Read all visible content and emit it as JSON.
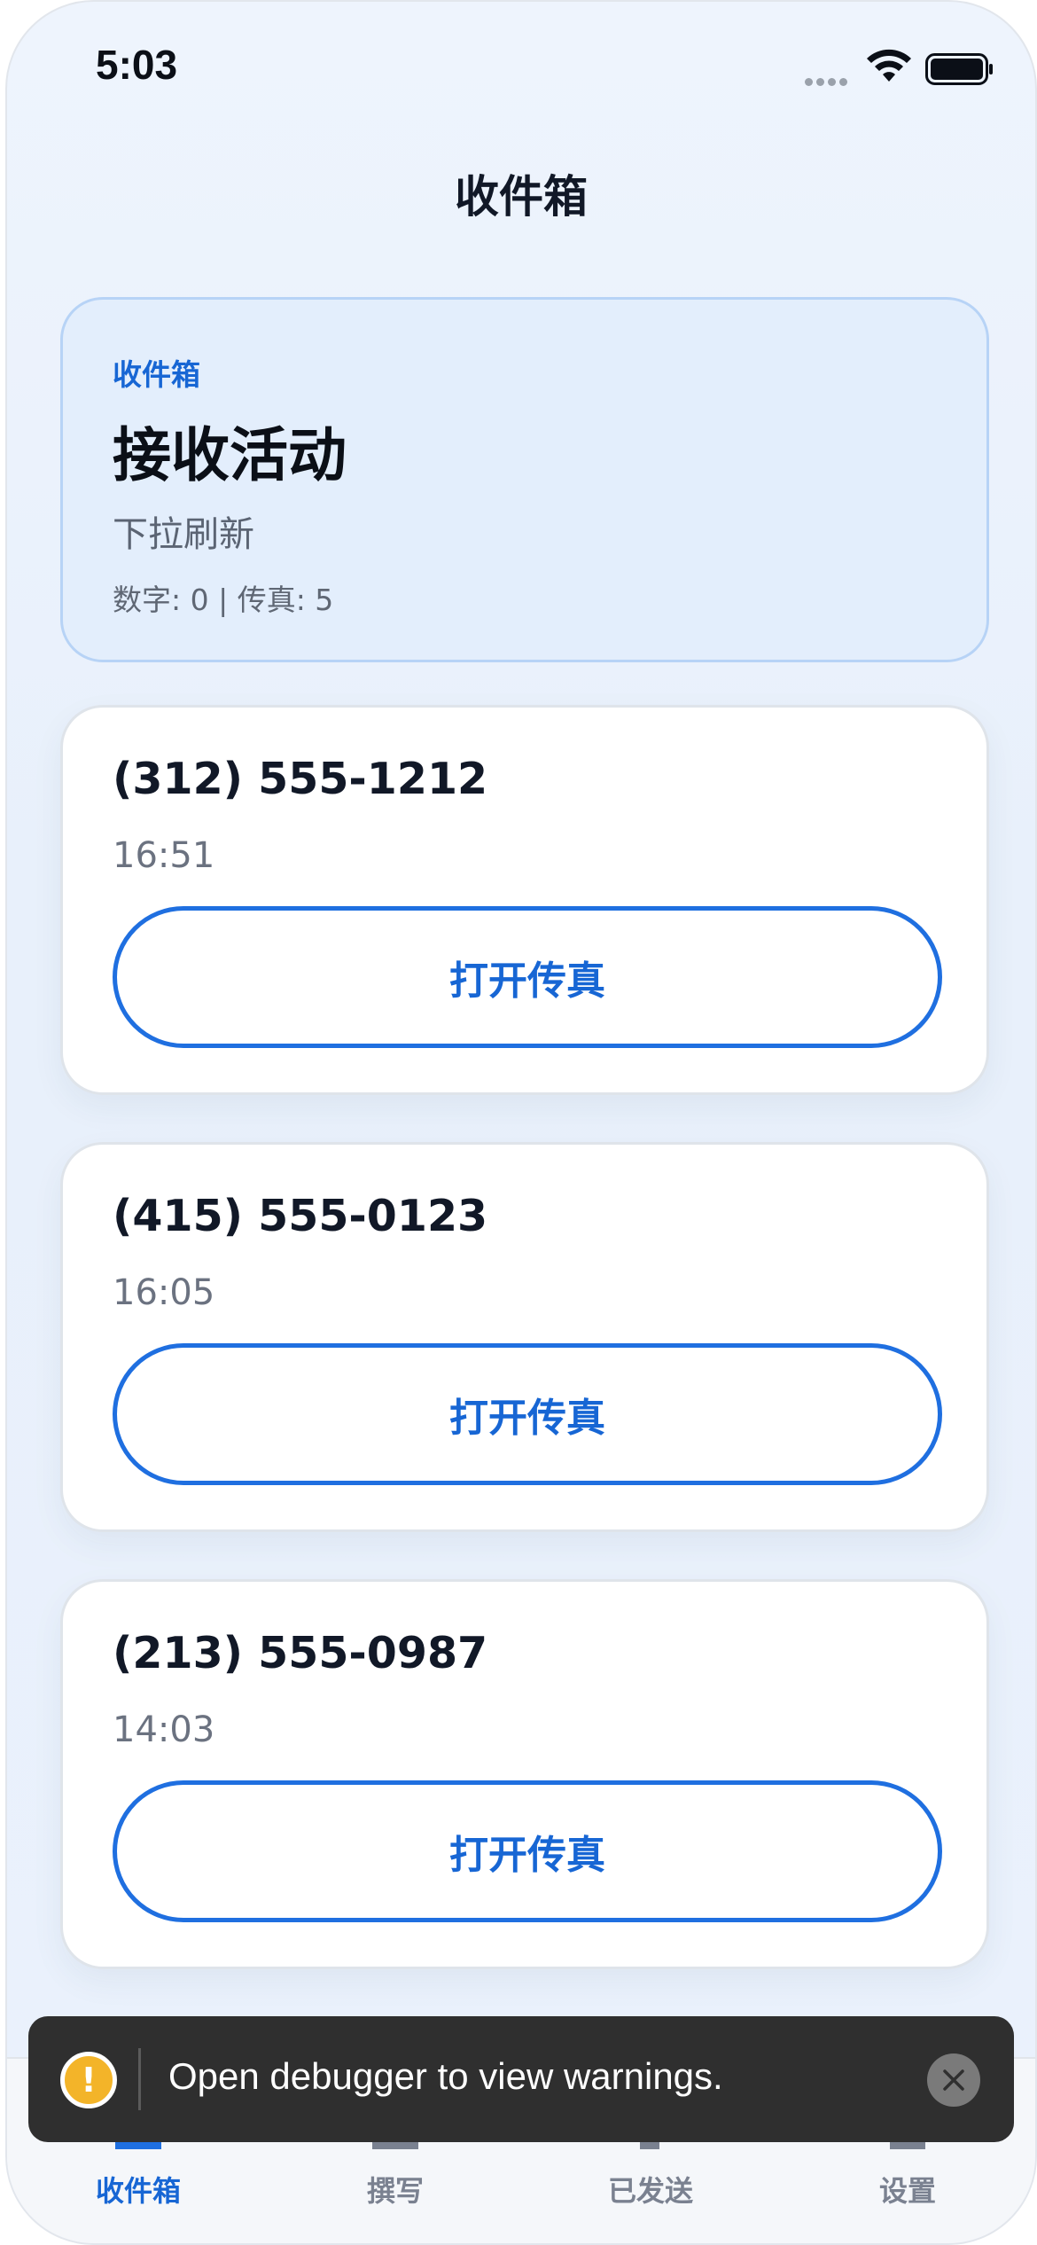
{
  "status_bar": {
    "time": "5:03"
  },
  "nav": {
    "title": "收件箱"
  },
  "hero": {
    "kicker": "收件箱",
    "title": "接收活动",
    "subtitle": "下拉刷新",
    "stats": "数字: 0 | 传真: 5"
  },
  "faxes": [
    {
      "number": "(312) 555-1212",
      "time": "16:51",
      "button": "打开传真"
    },
    {
      "number": "(415) 555-0123",
      "time": "16:05",
      "button": "打开传真"
    },
    {
      "number": "(213) 555-0987",
      "time": "14:03",
      "button": "打开传真"
    }
  ],
  "tabs": [
    {
      "label": "收件箱",
      "active": true
    },
    {
      "label": "撰写",
      "active": false
    },
    {
      "label": "已发送",
      "active": false
    },
    {
      "label": "设置",
      "active": false
    }
  ],
  "toast": {
    "message": "Open debugger to view warnings.",
    "icon": "!"
  },
  "colors": {
    "accent": "#1f6fe0",
    "warning": "#f3b429"
  }
}
